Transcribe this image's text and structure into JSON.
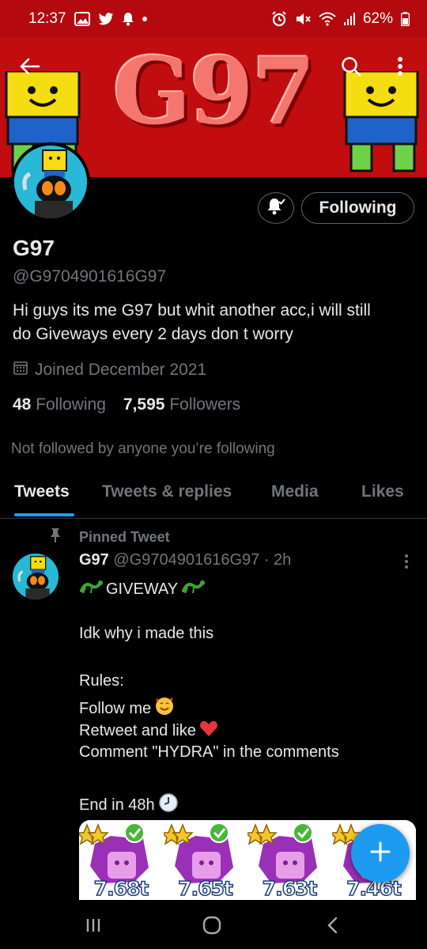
{
  "status_bar": {
    "time": "12:37",
    "battery": "62%"
  },
  "banner": {
    "title": "G97",
    "accent": "#c10d10"
  },
  "header": {
    "back_icon": "back-arrow-icon",
    "search_icon": "search-icon",
    "more_icon": "more-vertical-icon"
  },
  "profile": {
    "display_name": "G97",
    "handle": "@G9704901616G97",
    "bio_lines": [
      "Hi guys its me G97 but whit another acc,i will still",
      "do Giveways every 2 days don t worry"
    ],
    "joined": "Joined December 2021",
    "following_count": "48",
    "following_label": "Following",
    "followers_count": "7,595",
    "followers_label": "Followers",
    "not_followed": "Not followed by anyone you’re following",
    "follow_button": "Following"
  },
  "tabs": [
    {
      "label": "Tweets",
      "active": true
    },
    {
      "label": "Tweets & replies",
      "active": false
    },
    {
      "label": "Media",
      "active": false
    },
    {
      "label": "Likes",
      "active": false
    }
  ],
  "tweet": {
    "pinned_label": "Pinned Tweet",
    "author": "G97",
    "handle_time": "@G9704901616G97 · 2h",
    "title": "GIVEWAY",
    "lines": [
      "Idk why i made this",
      "Rules:",
      "Follow me",
      "Retweet and like",
      "Comment \"HYDRA\" in the comments",
      "End in 48h"
    ],
    "media_labels": [
      "7.68t",
      "7.65t",
      "7.63t",
      "7.46t"
    ]
  },
  "colors": {
    "accent": "#1d9bf0",
    "secondary_text": "#71767b",
    "divider": "#2f3336"
  }
}
